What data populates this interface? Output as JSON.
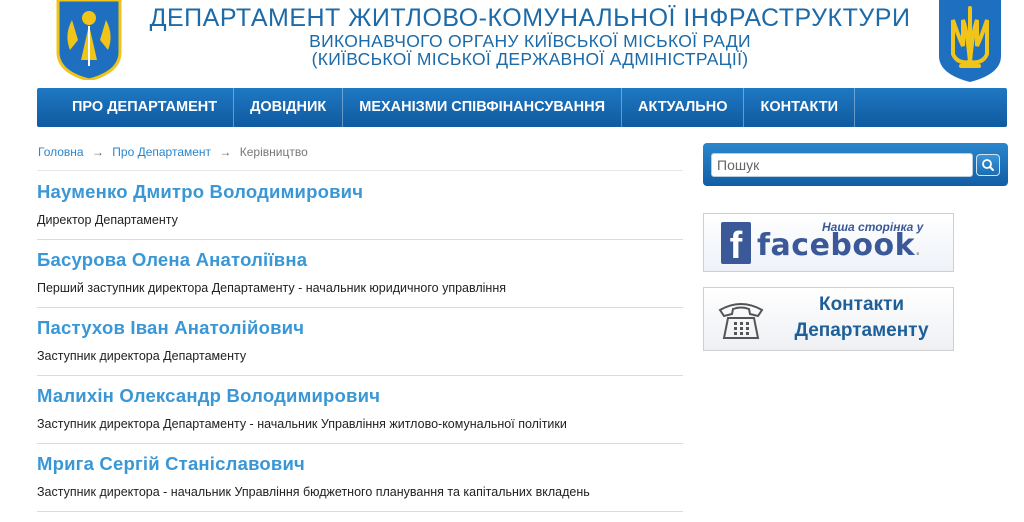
{
  "header": {
    "title_main": "ДЕПАРТАМЕНТ ЖИТЛОВО-КОМУНАЛЬНОЇ ІНФРАСТРУКТУРИ",
    "title_sub1": "ВИКОНАВЧОГО ОРГАНУ КИЇВСЬКОЇ МІСЬКОЇ РАДИ",
    "title_sub2": "(КИЇВСЬКОЇ МІСЬКОЇ ДЕРЖАВНОЇ АДМІНІСТРАЦІЇ)",
    "left_emblem": "kyiv-coat-of-arms-icon",
    "right_emblem": "ukraine-trident-icon"
  },
  "nav": {
    "items": [
      "ПРО ДЕПАРТАМЕНТ",
      "ДОВІДНИК",
      "МЕХАНІЗМИ СПІВФІНАНСУВАННЯ",
      "АКТУАЛЬНО",
      "КОНТАКТИ"
    ]
  },
  "breadcrumb": {
    "home": "Головна",
    "section": "Про Департамент",
    "current": "Керівництво",
    "separator": "→"
  },
  "people": [
    {
      "name": "Науменко Дмитро Володимирович",
      "position": "Директор Департаменту"
    },
    {
      "name": "Басурова Олена Анатоліївна",
      "position": "Перший заступник директора Департаменту - начальник юридичного управління"
    },
    {
      "name": "Пастухов Іван Анатолійович",
      "position": "Заступник директора Департаменту"
    },
    {
      "name": "Малихін Олександр Володимирович",
      "position": "Заступник директора Департаменту - начальник Управління житлово-комунальної політики"
    },
    {
      "name": "Мрига Сергій Станіславович",
      "position": "Заступник директора - начальник Управління бюджетного планування та капітальних вкладень"
    }
  ],
  "sidebar": {
    "search_placeholder": "Пошук",
    "search_icon": "search-icon",
    "facebook_tagline": "Наша сторінка у",
    "facebook_word": "facebook",
    "facebook_dot": ".",
    "contacts_line1": "Контакти",
    "contacts_line2": "Департаменту",
    "contacts_icon": "telephone-icon"
  },
  "colors": {
    "brand_blue": "#1c6aa8",
    "nav_bg": "#1566ad",
    "name_link": "#3a97d6",
    "facebook_blue": "#3b5998",
    "coat_gold": "#f0c419",
    "coat_blue": "#1f6fc0"
  }
}
